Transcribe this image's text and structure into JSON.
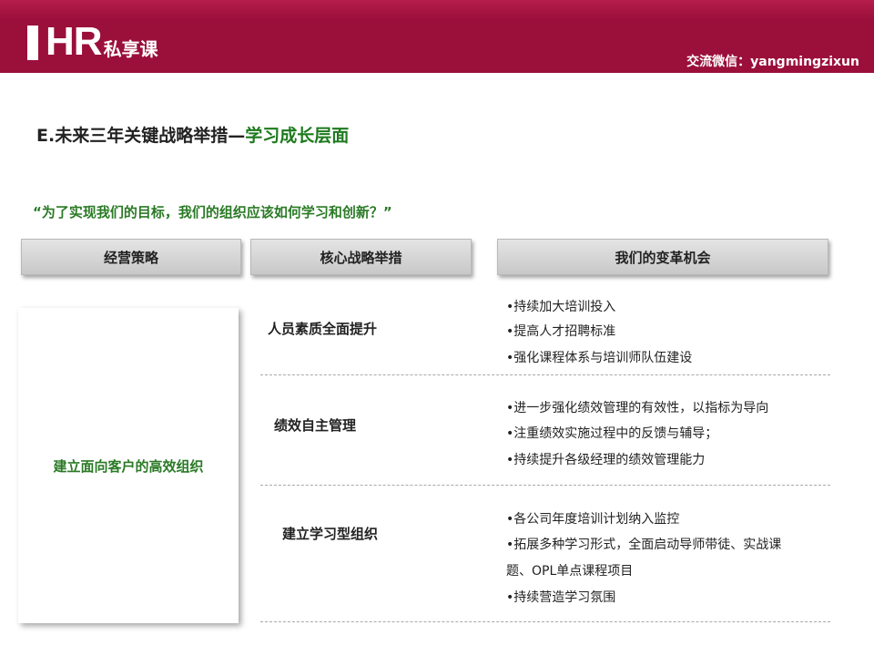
{
  "header": {
    "logo_mark": "HR",
    "logo_suffix": "私享课",
    "contact": "交流微信：yangmingzixun"
  },
  "slide": {
    "title_prefix": "E.未来三年关键战略举措—",
    "title_highlight": "学习成长层面",
    "question": "“为了实现我们的目标，我们的组织应该如何学习和创新？”"
  },
  "columns": [
    "经营策略",
    "核心战略举措",
    "我们的变革机会"
  ],
  "strategy": "建立面向客户的高效组织",
  "measures": [
    {
      "name": "人员素质全面提升",
      "opportunities": [
        "•持续加大培训投入",
        "•提高人才招聘标准",
        "•强化课程体系与培训师队伍建设"
      ]
    },
    {
      "name": "绩效自主管理",
      "opportunities": [
        "•进一步强化绩效管理的有效性，以指标为导向",
        "•注重绩效实施过程中的反馈与辅导；",
        "•持续提升各级经理的绩效管理能力"
      ]
    },
    {
      "name": "建立学习型组织",
      "opportunities": [
        "•各公司年度培训计划纳入监控",
        "•拓展多种学习形式，全面启动导师带徒、实战课",
        "题、OPL单点课程项目",
        "•持续营造学习氛围"
      ]
    }
  ],
  "colors": {
    "banner": "#9b0f3b",
    "accent_green": "#2a7a25",
    "header_box": "#d4d4d4"
  }
}
